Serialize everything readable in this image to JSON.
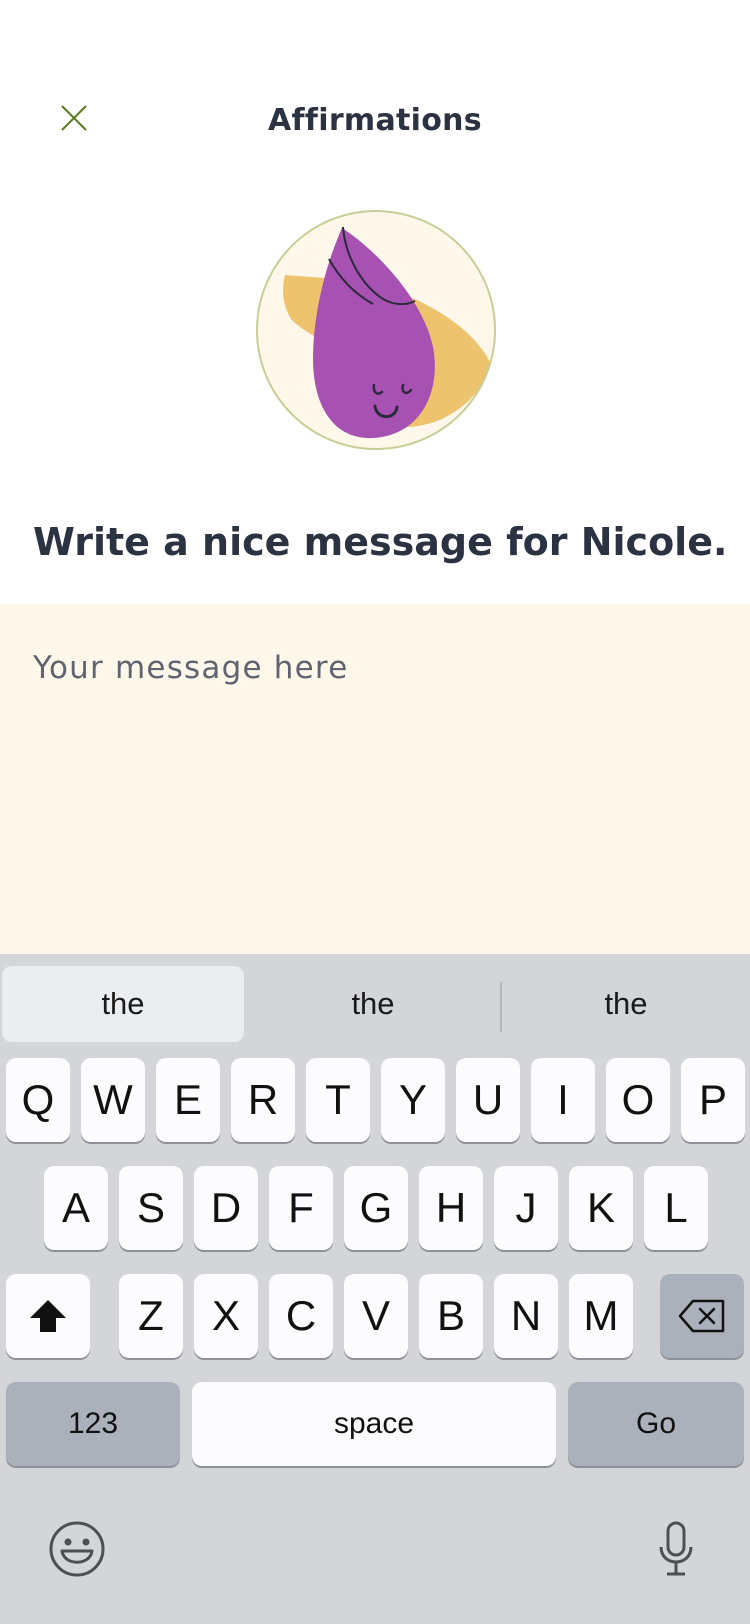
{
  "header": {
    "title": "Affirmations",
    "close_icon": "close-icon"
  },
  "illustration": {
    "icon": "smiling-drop-character-illustration",
    "colors": {
      "circle_bg": "#fef7ea",
      "circle_border": "#c7cf96",
      "leaf": "#eec36e",
      "drop": "#a752b3"
    }
  },
  "prompt": "Write a nice message for Nicole.",
  "message": {
    "value": "",
    "placeholder": "Your message here"
  },
  "keyboard": {
    "suggestions": [
      "the",
      "the",
      "the"
    ],
    "row1": [
      "Q",
      "W",
      "E",
      "R",
      "T",
      "Y",
      "U",
      "I",
      "O",
      "P"
    ],
    "row2": [
      "A",
      "S",
      "D",
      "F",
      "G",
      "H",
      "J",
      "K",
      "L"
    ],
    "row3": [
      "Z",
      "X",
      "C",
      "V",
      "B",
      "N",
      "M"
    ],
    "numbers_label": "123",
    "space_label": "space",
    "go_label": "Go",
    "shift_icon": "shift-icon",
    "backspace_icon": "backspace-icon",
    "emoji_icon": "emoji-icon",
    "mic_icon": "microphone-icon"
  },
  "colors": {
    "accent_green": "#5a7a1e",
    "text": "#2b3241",
    "message_bg": "#fef7ea",
    "keyboard_bg": "#d3d5d9"
  }
}
